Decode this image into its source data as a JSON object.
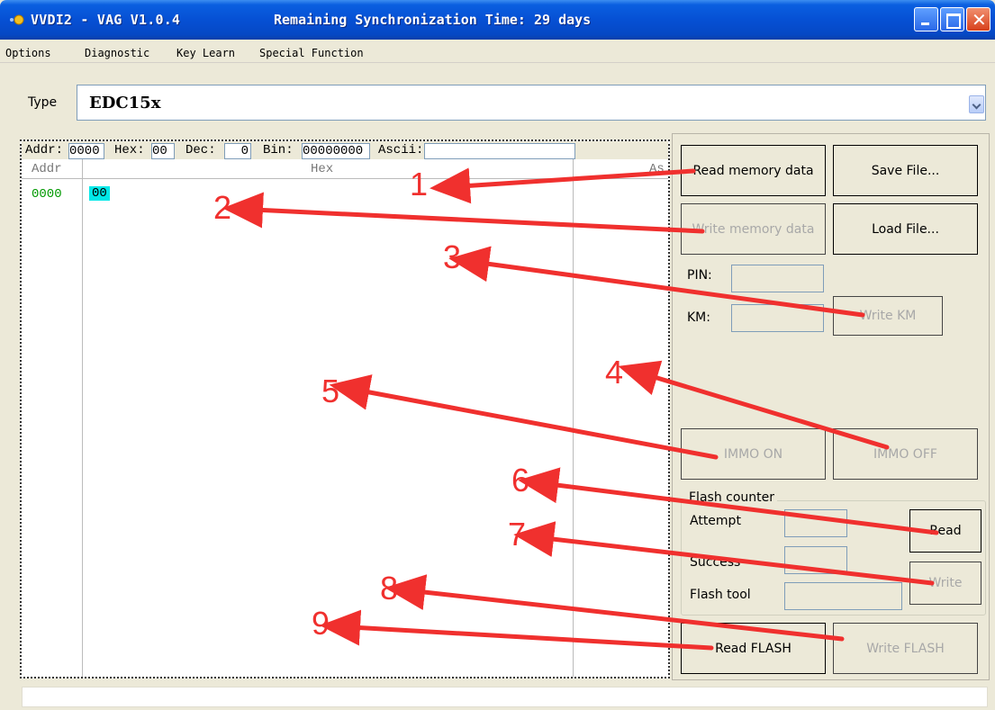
{
  "window": {
    "title": "VVDI2 - VAG V1.0.4",
    "sync_text": "Remaining Synchronization Time: 29 days"
  },
  "menu": [
    "Options",
    "Diagnostic",
    "Key Learn",
    "Special Function"
  ],
  "type_row": {
    "label": "Type",
    "value": "EDC15x"
  },
  "hex_view": {
    "header": {
      "addr_label": "Addr:",
      "addr_value": "0000",
      "hex_label": "Hex:",
      "hex_value": "00",
      "dec_label": "Dec:",
      "dec_value": "0",
      "bin_label": "Bin:",
      "bin_value": "00000000",
      "ascii_label": "Ascii:"
    },
    "columns": {
      "addr": "Addr",
      "hex": "Hex",
      "ascii": "As"
    },
    "rows": [
      {
        "addr": "0000",
        "bytes": "00"
      }
    ]
  },
  "buttons": {
    "read_memory": "Read memory data",
    "save_file": "Save File...",
    "write_memory": "Write memory data",
    "load_file": "Load File...",
    "write_km": "Write KM",
    "immo_on": "IMMO ON",
    "immo_off": "IMMO OFF",
    "fc_read": "Read",
    "fc_write": "Write",
    "read_flash": "Read FLASH",
    "write_flash": "Write FLASH"
  },
  "labels": {
    "pin": "PIN:",
    "km": "KM:",
    "flash_counter": "Flash counter",
    "attempt": "Attempt",
    "success": "Success",
    "flash_tool": "Flash tool"
  },
  "annotations": [
    "1",
    "2",
    "3",
    "4",
    "5",
    "6",
    "7",
    "8",
    "9"
  ],
  "colors": {
    "titlebar": "#0650d4",
    "arrow": "#f0302e",
    "addr_text": "#009900",
    "byte_highlight": "#00e8e8"
  }
}
